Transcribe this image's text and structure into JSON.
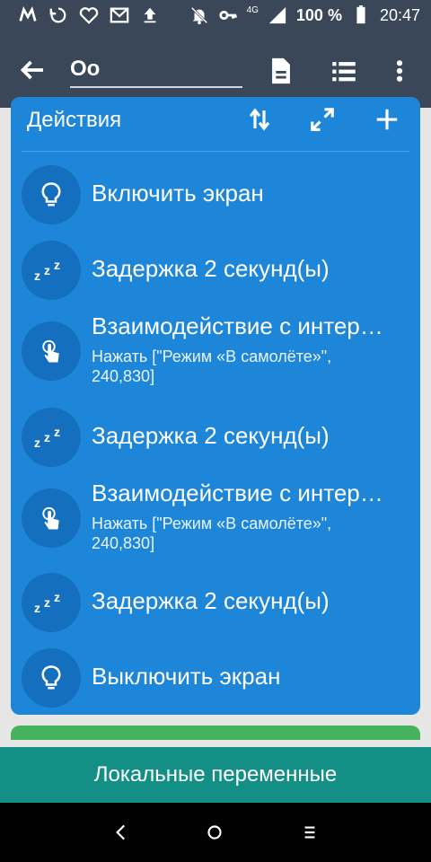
{
  "status_bar": {
    "signal_label": "4G",
    "battery": "100 %",
    "time": "20:47"
  },
  "app_bar": {
    "title_value": "Оо"
  },
  "actions_panel": {
    "title": "Действия",
    "items": [
      {
        "title": "Включить экран",
        "subtitle": ""
      },
      {
        "title": "Задержка 2 секунд(ы)",
        "subtitle": ""
      },
      {
        "title": "Взаимодействие с интер…",
        "subtitle": "Нажать [\"Режим «В самолёте»\", 240,830]"
      },
      {
        "title": "Задержка 2 секунд(ы)",
        "subtitle": ""
      },
      {
        "title": "Взаимодействие с интер…",
        "subtitle": "Нажать [\"Режим «В самолёте»\", 240,830]"
      },
      {
        "title": "Задержка 2 секунд(ы)",
        "subtitle": ""
      },
      {
        "title": "Выключить экран",
        "subtitle": ""
      }
    ]
  },
  "bottom_button": {
    "label": "Локальные переменные"
  },
  "icons": {
    "bulb": "lightbulb-icon",
    "sleep": "sleep-zzz-icon",
    "touch": "touch-icon"
  },
  "colors": {
    "app_bar": "#3a4758",
    "panel": "#1d86d8",
    "circle": "#146fbf",
    "bottom_button": "#138f86",
    "green_strip": "#44b35b"
  }
}
